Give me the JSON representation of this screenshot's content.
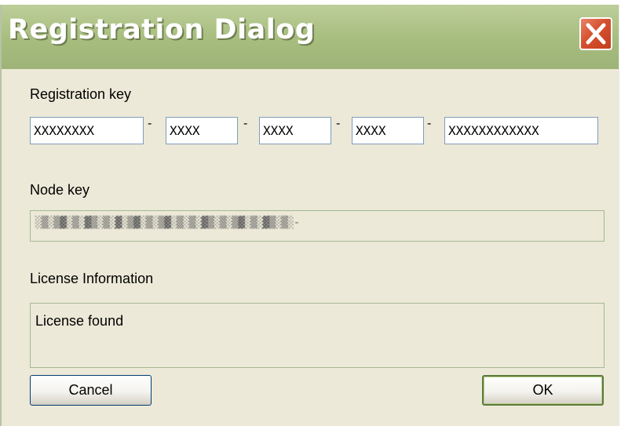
{
  "window": {
    "title": "Registration Dialog",
    "close_label": "×"
  },
  "registration": {
    "label": "Registration key",
    "fields": [
      {
        "value": "XXXXXXXX"
      },
      {
        "value": "XXXX"
      },
      {
        "value": "XXXX"
      },
      {
        "value": "XXXX"
      },
      {
        "value": "XXXXXXXXXXXX"
      }
    ],
    "separator": "-"
  },
  "node_key": {
    "label": "Node key",
    "value": "░▒░▒▓░▒░▓▒░▒░▓░▒▓░▒░▒▓░▒░▒░▓▒░▒░▒▓░▒░▓▒░▒░-"
  },
  "license": {
    "label": "License Information",
    "value": "License found"
  },
  "buttons": {
    "cancel": "Cancel",
    "ok": "OK"
  },
  "colors": {
    "titlebar": "#a7bd7e",
    "body": "#ece9d8",
    "close": "#d5512e"
  }
}
